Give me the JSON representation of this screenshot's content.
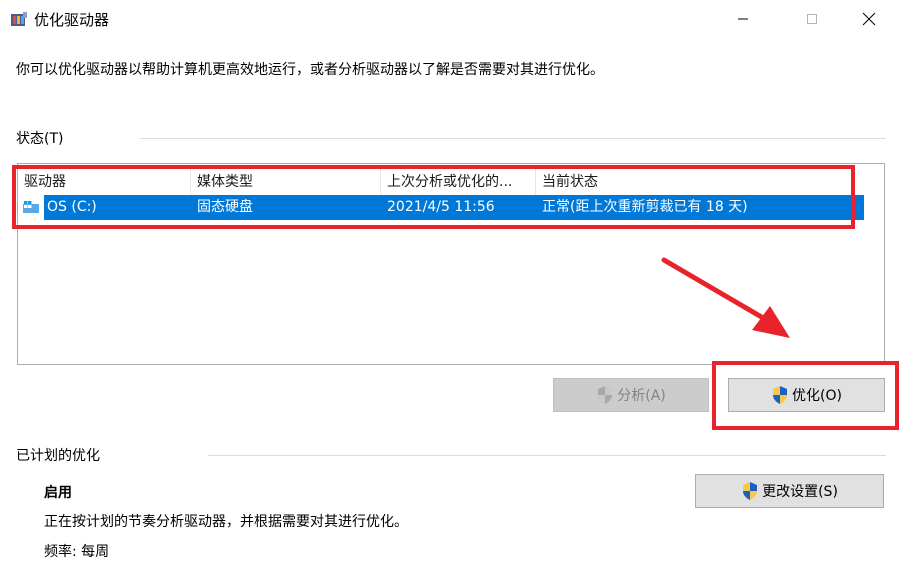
{
  "window": {
    "title": "优化驱动器",
    "description": "你可以优化驱动器以帮助计算机更高效地运行，或者分析驱动器以了解是否需要对其进行优化。"
  },
  "status": {
    "group_label": "状态(T)",
    "columns": [
      "驱动器",
      "媒体类型",
      "上次分析或优化的...",
      "当前状态"
    ],
    "rows": [
      {
        "drive": "OS (C:)",
        "media_type": "固态硬盘",
        "last_run": "2021/4/5 11:56",
        "current_status": "正常(距上次重新剪裁已有 18 天)",
        "selected": true
      }
    ]
  },
  "buttons": {
    "analyze_label": "分析(A)",
    "optimize_label": "优化(O)",
    "change_settings_label": "更改设置(S)"
  },
  "scheduled": {
    "group_label": "已计划的优化",
    "state": "启用",
    "description": "正在按计划的节奏分析驱动器，并根据需要对其进行优化。",
    "frequency": "频率: 每周"
  },
  "colors": {
    "selection": "#0078d7",
    "highlight_box": "#e8232b",
    "arrow": "#e8232b"
  },
  "icons": {
    "app": "defrag-app-icon",
    "drive": "drive-icon",
    "shield": "uac-shield-icon"
  }
}
